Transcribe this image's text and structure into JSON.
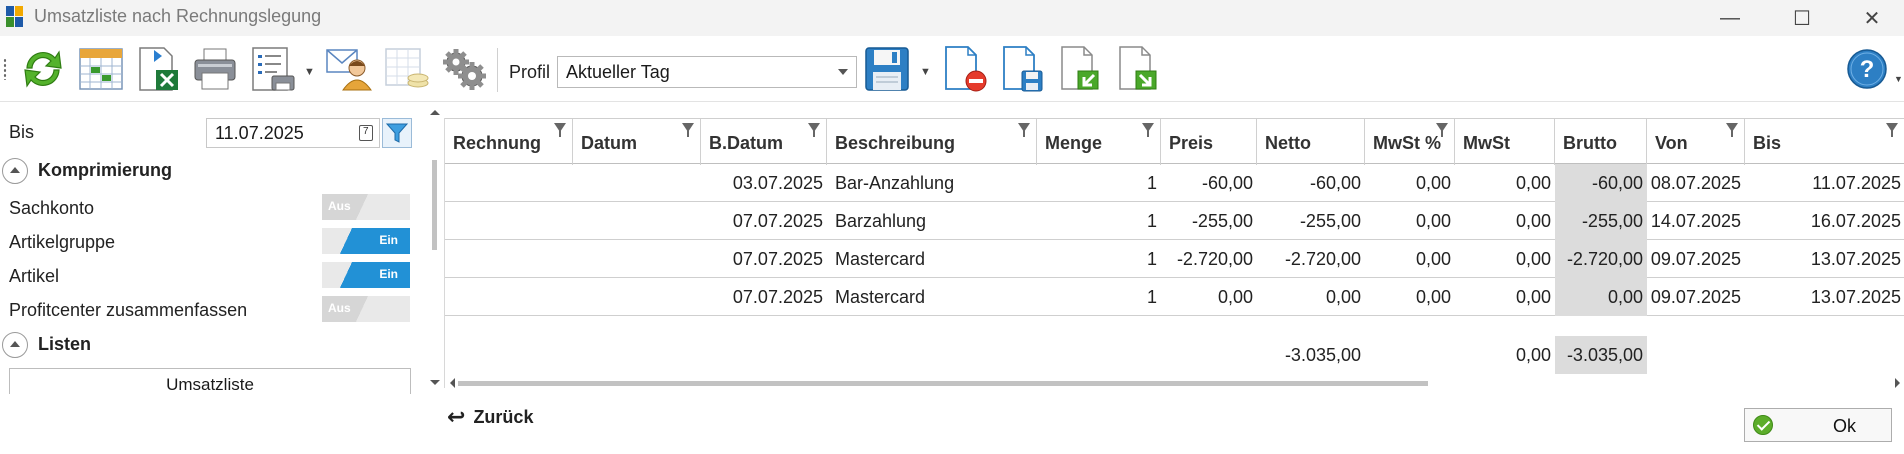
{
  "window": {
    "title": "Umsatzliste nach Rechnungslegung",
    "minimize_glyph": "—",
    "maximize_glyph": "☐",
    "close_glyph": "✕"
  },
  "toolbar": {
    "profil_label": "Profil",
    "profil_value": "Aktueller Tag",
    "icons": [
      "refresh-icon",
      "calendar-grid-icon",
      "excel-export-icon",
      "printer-icon",
      "print-layout-icon",
      "mail-contact-icon",
      "grid-coins-icon",
      "settings-gears-icon",
      "save-disk-icon",
      "delete-document-icon",
      "save-document-icon",
      "import-document-icon",
      "export-document-icon",
      "help-icon"
    ]
  },
  "left_panel": {
    "bis_label": "Bis",
    "bis_value": "11.07.2025",
    "komprimierung": {
      "title": "Komprimierung",
      "items": [
        {
          "label": "Sachkonto",
          "toggle": "Aus",
          "on": false
        },
        {
          "label": "Artikelgruppe",
          "toggle": "Ein",
          "on": true
        },
        {
          "label": "Artikel",
          "toggle": "Ein",
          "on": true
        },
        {
          "label": "Profitcenter zusammenfassen",
          "toggle": "Aus",
          "on": false
        }
      ]
    },
    "listen": {
      "title": "Listen",
      "button": "Umsatzliste"
    }
  },
  "grid": {
    "columns": [
      "Rechnung",
      "Datum",
      "B.Datum",
      "Beschreibung",
      "Menge",
      "Preis",
      "Netto",
      "MwSt %",
      "MwSt",
      "Brutto",
      "Von",
      "Bis"
    ],
    "rows": [
      [
        "",
        "",
        "03.07.2025",
        "Bar-Anzahlung",
        "1",
        "-60,00",
        "-60,00",
        "0,00",
        "0,00",
        "-60,00",
        "08.07.2025",
        "11.07.2025"
      ],
      [
        "",
        "",
        "07.07.2025",
        "Barzahlung",
        "1",
        "-255,00",
        "-255,00",
        "0,00",
        "0,00",
        "-255,00",
        "14.07.2025",
        "16.07.2025"
      ],
      [
        "",
        "",
        "07.07.2025",
        "Mastercard",
        "1",
        "-2.720,00",
        "-2.720,00",
        "0,00",
        "0,00",
        "-2.720,00",
        "09.07.2025",
        "13.07.2025"
      ],
      [
        "",
        "",
        "07.07.2025",
        "Mastercard",
        "1",
        "0,00",
        "0,00",
        "0,00",
        "0,00",
        "0,00",
        "09.07.2025",
        "13.07.2025"
      ]
    ],
    "totals": {
      "netto": "-3.035,00",
      "mwst": "0,00",
      "brutto": "-3.035,00"
    }
  },
  "footer": {
    "back_label": "Zurück",
    "ok_label": "Ok"
  }
}
